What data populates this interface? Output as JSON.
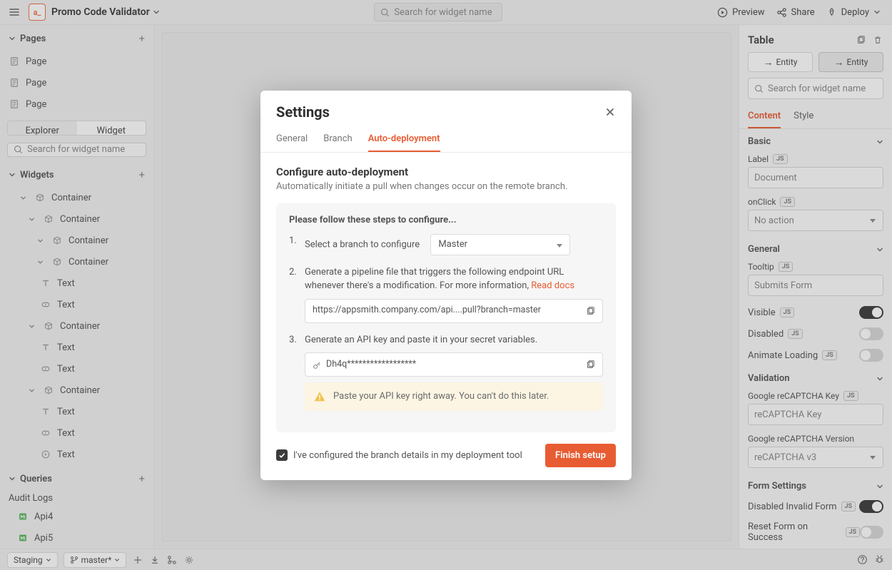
{
  "topbar": {
    "app_title": "Promo Code Validator",
    "search_placeholder": "Search for widget name",
    "preview": "Preview",
    "share": "Share",
    "deploy": "Deploy"
  },
  "left": {
    "pages_label": "Pages",
    "pages": [
      "Page",
      "Page",
      "Page"
    ],
    "seg": {
      "explorer": "Explorer",
      "widget": "Widget"
    },
    "search_placeholder": "Search for widget name",
    "widgets_label": "Widgets",
    "tree": [
      {
        "label": "Container",
        "depth": 1,
        "icon": "container",
        "chev": true
      },
      {
        "label": "Container",
        "depth": 2,
        "icon": "container",
        "chev": true
      },
      {
        "label": "Container",
        "depth": 3,
        "icon": "container",
        "chev": true
      },
      {
        "label": "Container",
        "depth": 3,
        "icon": "container",
        "chev": true
      },
      {
        "label": "Text",
        "depth": 4,
        "icon": "text"
      },
      {
        "label": "Text",
        "depth": 4,
        "icon": "button"
      },
      {
        "label": "Container",
        "depth": 2,
        "icon": "container",
        "chev": true
      },
      {
        "label": "Text",
        "depth": 4,
        "icon": "text"
      },
      {
        "label": "Text",
        "depth": 4,
        "icon": "button"
      },
      {
        "label": "Container",
        "depth": 2,
        "icon": "container",
        "chev": true
      },
      {
        "label": "Text",
        "depth": 4,
        "icon": "text"
      },
      {
        "label": "Text",
        "depth": 4,
        "icon": "button"
      },
      {
        "label": "Text",
        "depth": 4,
        "icon": "play"
      }
    ],
    "queries_label": "Queries",
    "audit_label": "Audit Logs",
    "apis": [
      "Api4",
      "Api5"
    ]
  },
  "right": {
    "title": "Table",
    "entity1": "Entity",
    "entity2": "Entity",
    "search_placeholder": "Search for widget name",
    "tabs": {
      "content": "Content",
      "style": "Style"
    },
    "groups": {
      "basic": "Basic",
      "label_lbl": "Label",
      "label_ph": "Document",
      "onclick_lbl": "onClick",
      "onclick_val": "No action",
      "general": "General",
      "tooltip_lbl": "Tooltip",
      "tooltip_ph": "Submits Form",
      "visible": "Visible",
      "disabled": "Disabled",
      "animate": "Animate Loading",
      "validation": "Validation",
      "recaptcha_key": "Google reCAPTCHA Key",
      "recaptcha_key_ph": "reCAPTCHA Key",
      "recaptcha_ver": "Google reCAPTCHA Version",
      "recaptcha_ver_val": "reCAPTCHA v3",
      "form_settings": "Form Settings",
      "disabled_invalid": "Disabled Invalid Form",
      "reset_form": "Reset Form on Success"
    }
  },
  "bottom": {
    "env": "Staging",
    "branch": "master*"
  },
  "modal": {
    "title": "Settings",
    "tabs": {
      "general": "General",
      "branch": "Branch",
      "auto": "Auto-deployment"
    },
    "heading": "Configure auto-deployment",
    "sub": "Automatically initiate a pull when changes occur on the remote branch.",
    "steps_header": "Please follow these steps to configure...",
    "step1_text": "Select a branch to configure",
    "branch_sel": "Master",
    "step2_text": "Generate a pipeline file that triggers the following endpoint URL whenever there's a modification. For more information, ",
    "read_docs": "Read docs",
    "endpoint_url": "https://appsmith.company.com/api....pull?branch=master",
    "step3_text": "Generate an API key and paste it in your secret variables.",
    "api_key": "Dh4q******************",
    "warn": "Paste your API key right away. You can't do this later.",
    "ack": "I've configured the branch details in my deployment tool",
    "finish": "Finish setup"
  }
}
